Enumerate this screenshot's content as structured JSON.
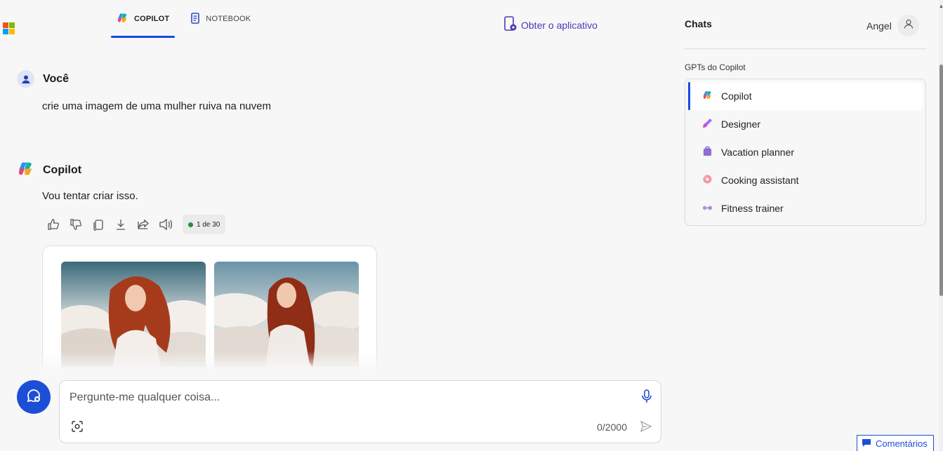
{
  "tabs": [
    {
      "label": "COPILOT",
      "icon": "copilot-icon",
      "active": true
    },
    {
      "label": "NOTEBOOK",
      "icon": "notebook-icon",
      "active": false
    }
  ],
  "header": {
    "get_app_label": "Obter o aplicativo"
  },
  "conversation": {
    "user": {
      "name": "Você",
      "text": "crie uma imagem de uma mulher ruiva na nuvem"
    },
    "copilot": {
      "name": "Copilot",
      "text": "Vou tentar criar isso.",
      "counter": "1 de 30"
    },
    "actions": [
      "thumbs-up-icon",
      "thumbs-down-icon",
      "copy-icon",
      "download-icon",
      "share-icon",
      "speaker-icon"
    ]
  },
  "composer": {
    "placeholder": "Pergunte-me qualquer coisa...",
    "char_count": "0/2000"
  },
  "sidebar": {
    "title": "Chats",
    "user_name": "Angel",
    "gpts_label": "GPTs do Copilot",
    "items": [
      {
        "label": "Copilot",
        "icon": "copilot-icon",
        "active": true
      },
      {
        "label": "Designer",
        "icon": "designer-icon",
        "active": false
      },
      {
        "label": "Vacation planner",
        "icon": "suitcase-icon",
        "active": false
      },
      {
        "label": "Cooking assistant",
        "icon": "donut-icon",
        "active": false
      },
      {
        "label": "Fitness trainer",
        "icon": "dumbbell-icon",
        "active": false
      }
    ]
  },
  "feedback_label": "Comentários",
  "colors": {
    "accent": "#174ae4",
    "app_link": "#4a3bb5",
    "status_dot": "#2b8a3e"
  }
}
